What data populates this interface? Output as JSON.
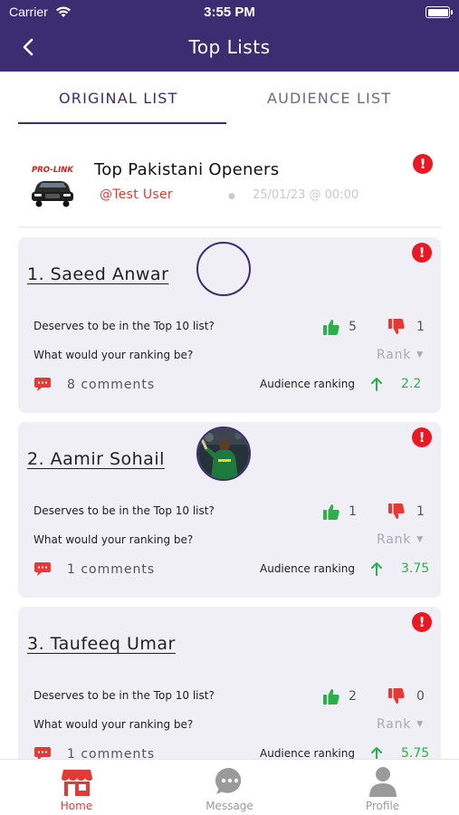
{
  "status_bar": {
    "carrier": "Carrier",
    "time": "3:55 PM"
  },
  "header": {
    "title": "Top Lists",
    "back_icon": "chevron-left-icon"
  },
  "tabs": [
    {
      "label": "ORIGINAL LIST",
      "active": true
    },
    {
      "label": "AUDIENCE LIST",
      "active": false
    }
  ],
  "list": {
    "title": "Top Pakistani Openers",
    "user": "@Test User",
    "date": "25/01/23 @ 00:00",
    "logo_text": "PRO-LINK"
  },
  "questions": {
    "deserves": "Deserves to be in the Top 10 list?",
    "ranking": "What would your ranking be?",
    "rank_placeholder": "Rank",
    "audience_label": "Audience ranking"
  },
  "players": [
    {
      "name": "1. Saeed Anwar",
      "up": "5",
      "down": "1",
      "comments": "8 comments",
      "audience_ranking": "2.2",
      "has_photo": false
    },
    {
      "name": "2. Aamir Sohail",
      "up": "1",
      "down": "1",
      "comments": "1 comments",
      "audience_ranking": "3.75",
      "has_photo": true
    },
    {
      "name": "3. Taufeeq Umar",
      "up": "2",
      "down": "0",
      "comments": "1 comments",
      "audience_ranking": "5.75",
      "has_photo": false
    }
  ],
  "tabbar": [
    {
      "label": "Home",
      "icon": "store-icon",
      "active": true
    },
    {
      "label": "Message",
      "icon": "chat-icon",
      "active": false
    },
    {
      "label": "Profile",
      "icon": "person-icon",
      "active": false
    }
  ],
  "colors": {
    "primary": "#3c2c72",
    "accent_red": "#e53935",
    "positive_green": "#2ab14a",
    "card_bg": "#efeff5"
  }
}
